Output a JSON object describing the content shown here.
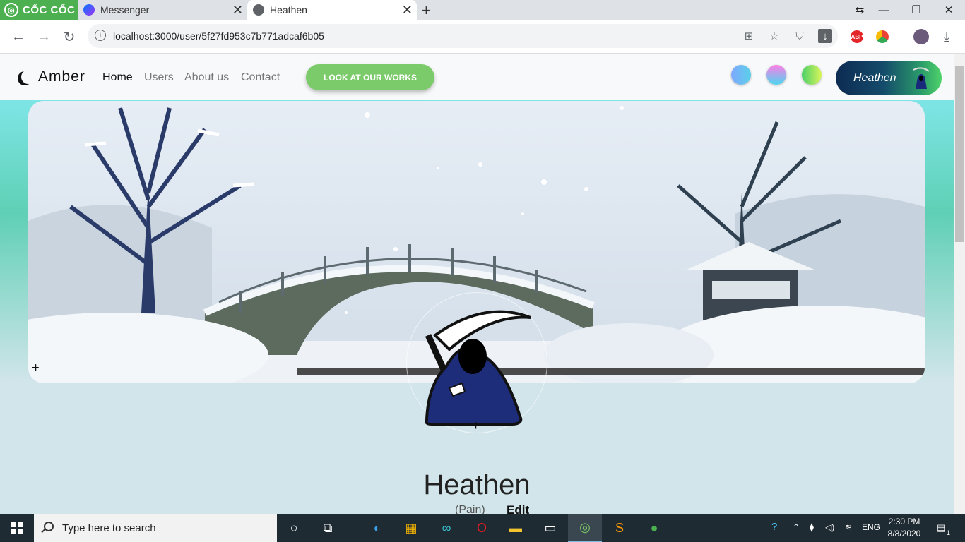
{
  "browser": {
    "brand_label": "CỐC CỐC",
    "tabs": [
      {
        "title": "Messenger",
        "active": false
      },
      {
        "title": "Heathen",
        "active": true
      }
    ],
    "new_tab": "+",
    "window_controls": {
      "restore_tabs": "⇆",
      "minimize": "—",
      "maximize": "❐",
      "close": "✕"
    },
    "url": "localhost:3000/user/5f27fd953c7b771adcaf6b05",
    "extensions": [
      {
        "name": "adblock-plus-icon",
        "label": "ABP",
        "color": "#e3262a"
      },
      {
        "name": "chrome-extension-icon",
        "label": "",
        "color": "#f4b400"
      }
    ]
  },
  "site": {
    "brand": "Amber",
    "nav": [
      {
        "label": "Home",
        "active": true
      },
      {
        "label": "Users",
        "active": false
      },
      {
        "label": "About us",
        "active": false
      },
      {
        "label": "Contact",
        "active": false
      }
    ],
    "cta_label": "LOOK AT OUR WORKS",
    "theme_swatches": [
      {
        "name": "theme-swatch-blue",
        "gradient": [
          "#7fa8ff",
          "#5ad0e8"
        ]
      },
      {
        "name": "theme-swatch-pink",
        "gradient": [
          "#ff7ee6",
          "#4ad7f0"
        ]
      },
      {
        "name": "theme-swatch-green",
        "gradient": [
          "#4ad06a",
          "#d8f55a"
        ]
      }
    ],
    "user_button_label": "Heathen"
  },
  "profile": {
    "name": "Heathen",
    "subtitle": "(Pain)",
    "edit_label": "Edit"
  },
  "taskbar": {
    "search_placeholder": "Type here to search",
    "apps": [
      "task-view-icon",
      "edge-icon",
      "store-icon",
      "infinity-icon",
      "opera-icon",
      "file-explorer-icon",
      "terminal-icon",
      "coccoc-icon",
      "sublime-icon",
      "mongodb-icon"
    ],
    "language": "ENG",
    "time": "2:30 PM",
    "date": "8/8/2020",
    "notifications": "1"
  },
  "colors": {
    "cta": "#7ccb6a",
    "page_bg": "#d1e5ea",
    "taskbar": "#1f2b33"
  }
}
